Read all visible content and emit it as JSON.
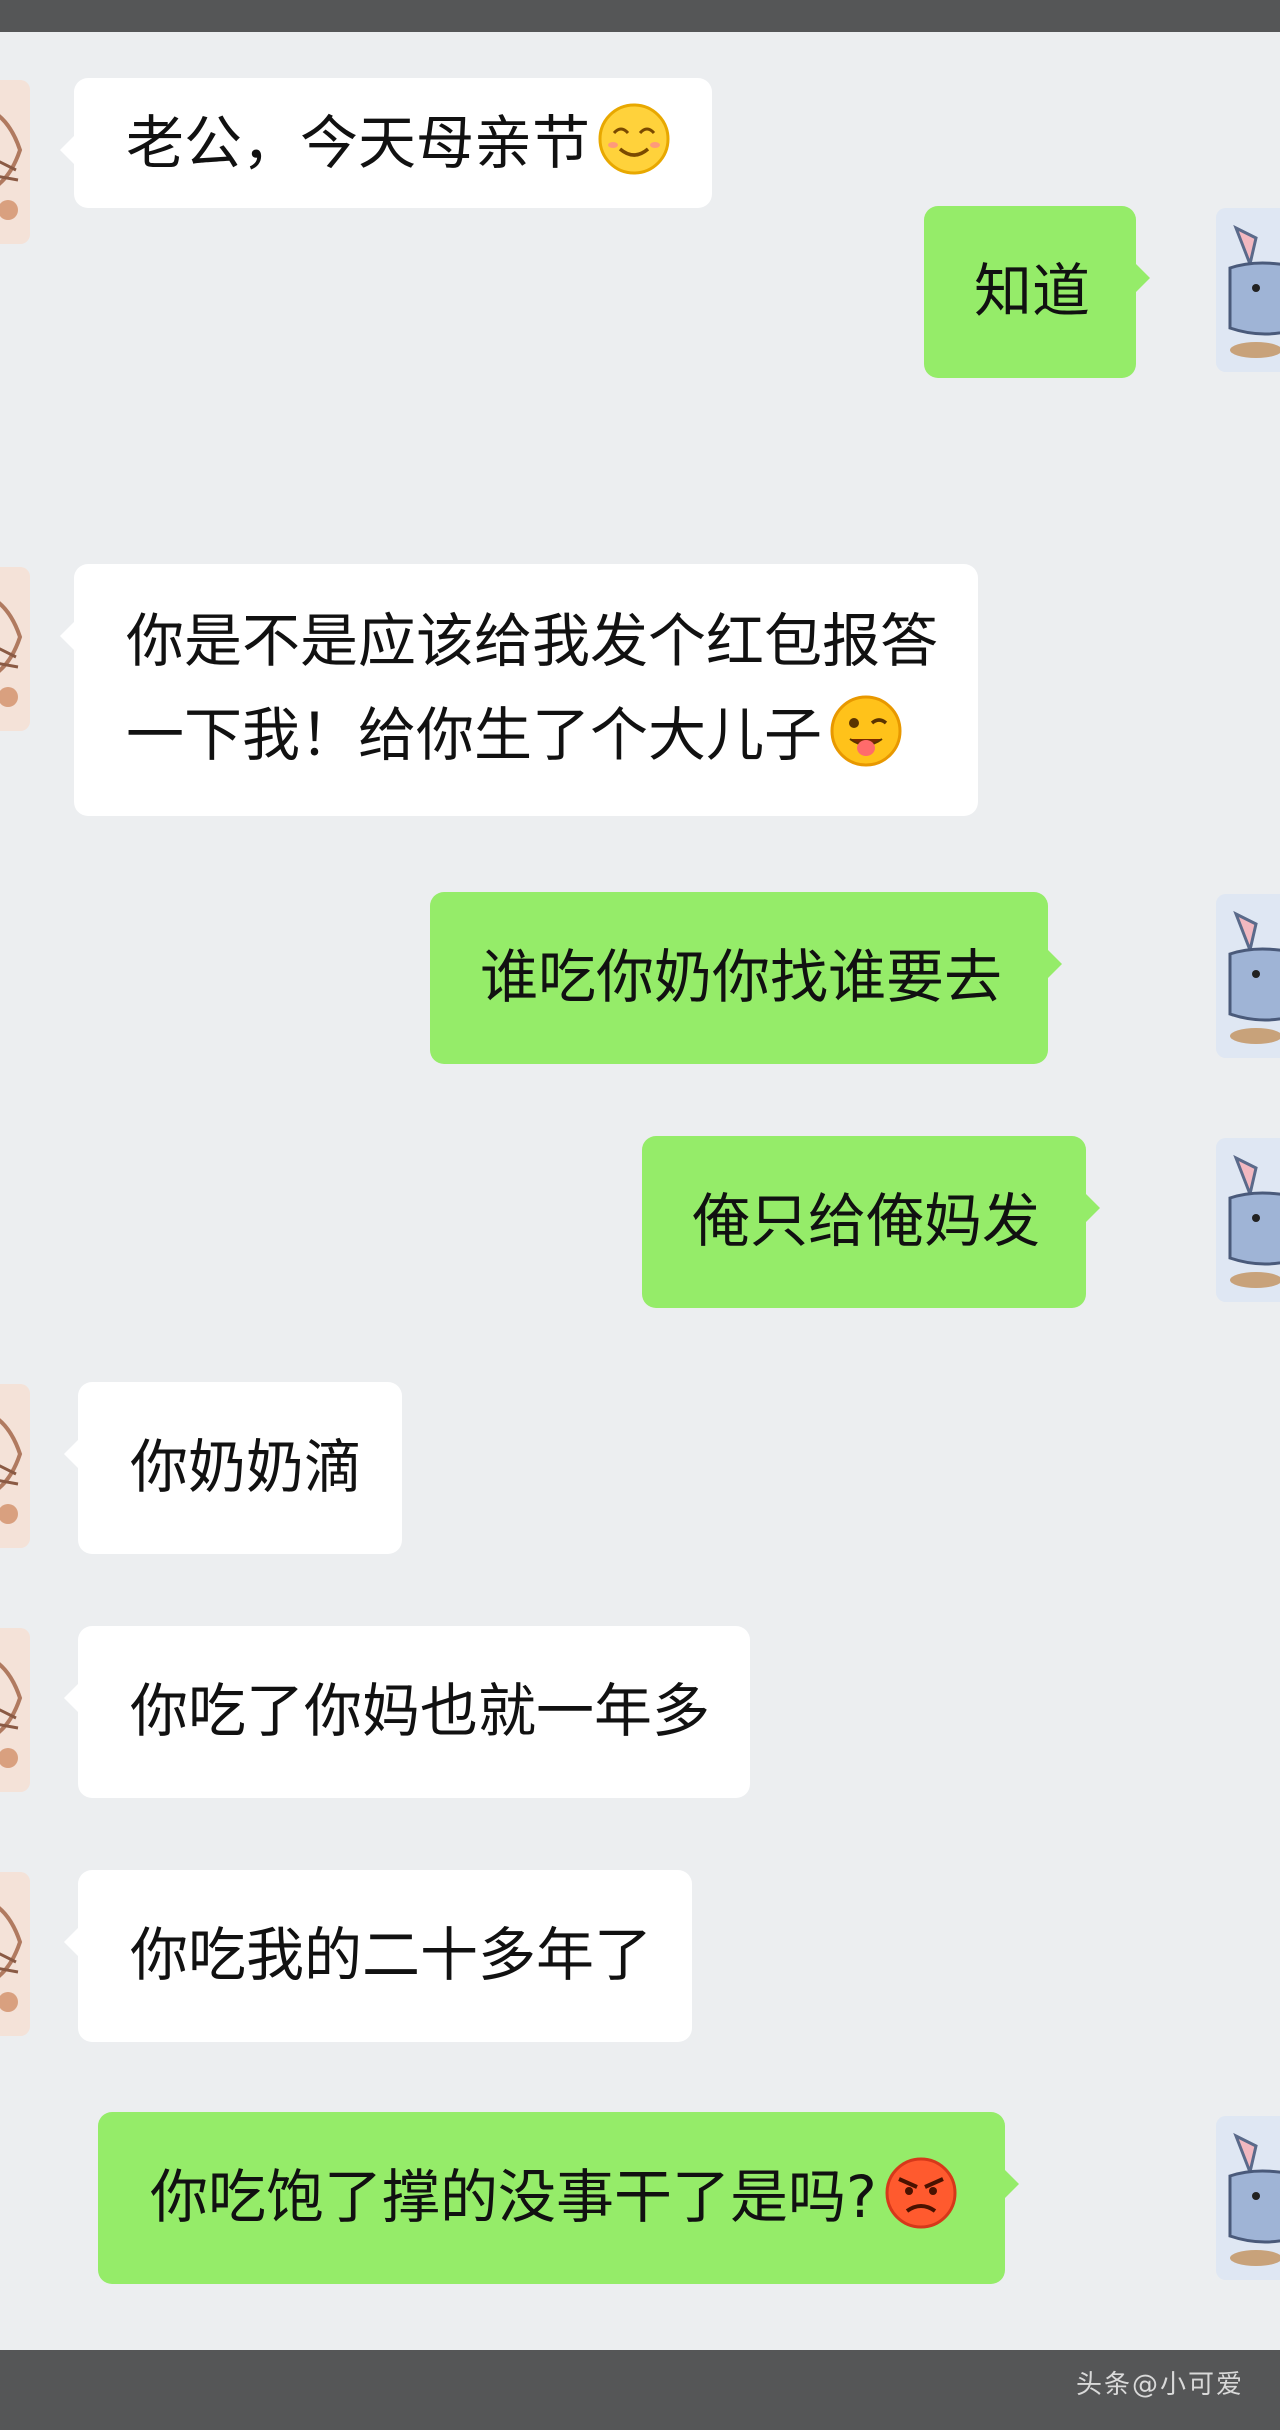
{
  "messages": [
    {
      "side": "left",
      "lines": [
        "老公，今天母亲节"
      ],
      "emoji": "smiling-face-emoji"
    },
    {
      "side": "right",
      "lines": [
        "知道"
      ]
    },
    {
      "side": "left",
      "lines": [
        "你是不是应该给我发个红包报答",
        "一下我！给你生了个大儿子"
      ],
      "emoji": "winking-tongue-emoji"
    },
    {
      "side": "right",
      "lines": [
        "谁吃你奶你找谁要去"
      ]
    },
    {
      "side": "right",
      "lines": [
        "俺只给俺妈发"
      ]
    },
    {
      "side": "left",
      "lines": [
        "你奶奶滴"
      ]
    },
    {
      "side": "left",
      "lines": [
        "你吃了你妈也就一年多"
      ]
    },
    {
      "side": "left",
      "lines": [
        "你吃我的二十多年了"
      ]
    },
    {
      "side": "right",
      "lines": [
        "你吃饱了撑的没事干了是吗?"
      ],
      "emoji": "angry-face-emoji"
    }
  ],
  "colors": {
    "left_bubble": "#ffffff",
    "right_bubble": "#95ec69",
    "chat_background": "#eceef0"
  },
  "watermark": "头条@小可爱"
}
